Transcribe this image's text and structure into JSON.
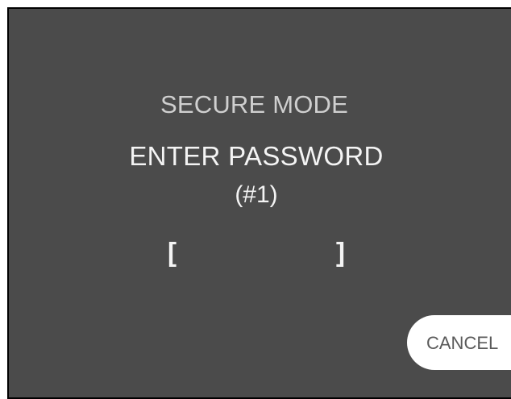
{
  "screen": {
    "title": "SECURE MODE",
    "prompt": "ENTER PASSWORD",
    "password_index": "(#1)",
    "password_field": {
      "open_bracket": "[",
      "close_bracket": "]",
      "value": ""
    },
    "cancel_label": "CANCEL"
  }
}
